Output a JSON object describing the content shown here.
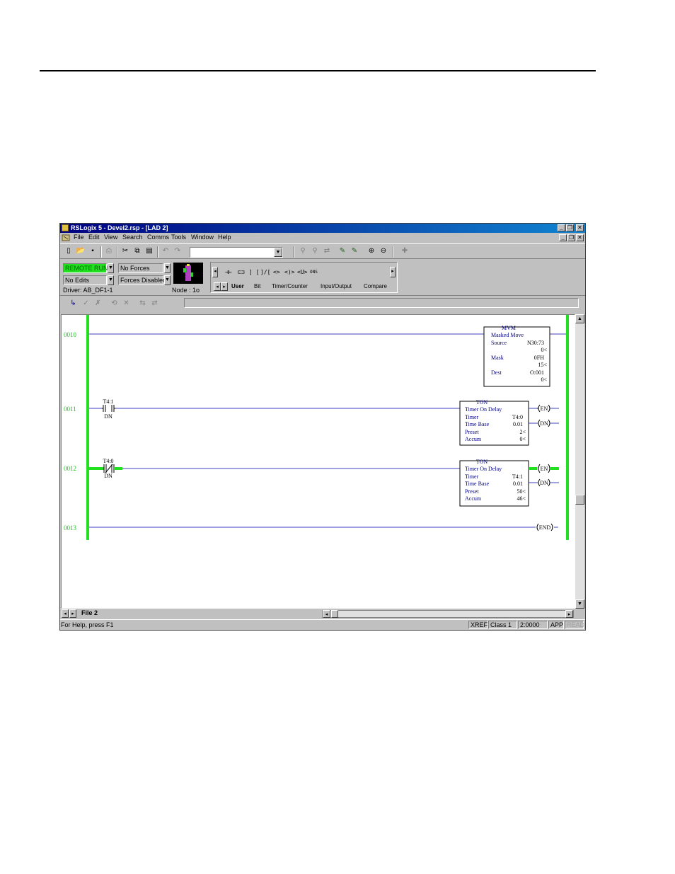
{
  "window": {
    "title": "RSLogix 5 - Devel2.rsp - [LAD 2]"
  },
  "menu": [
    "File",
    "Edit",
    "View",
    "Search",
    "Comms",
    "Tools",
    "Window",
    "Help"
  ],
  "status_panel": {
    "mode": "REMOTE RUN",
    "forces": "No Forces",
    "edits": "No Edits",
    "forces_enabled": "Forces Disabled",
    "driver": "Driver: AB_DF1-1",
    "node": "Node : 1o"
  },
  "instruction_palette": {
    "symbols": [
      "⊣⊢",
      "⊏⊐",
      "] [",
      "]/[",
      "<>",
      "<)>",
      "<U>",
      "ONS"
    ],
    "tabs": [
      "User",
      "Bit",
      "Timer/Counter",
      "Input/Output",
      "Compare"
    ]
  },
  "rungs": [
    {
      "number": "0010",
      "block": {
        "name": "MVM",
        "title": "Masked Move",
        "rows": [
          [
            "Source",
            "N30:73"
          ],
          [
            "",
            "0<"
          ],
          [
            "Mask",
            "0FH"
          ],
          [
            "",
            "15<"
          ],
          [
            "Dest",
            "O:001"
          ],
          [
            "",
            "0<"
          ]
        ]
      }
    },
    {
      "number": "0011",
      "contact": {
        "address": "T4:1",
        "bit": "DN"
      },
      "block": {
        "name": "TON",
        "title": "Timer On Delay",
        "rows": [
          [
            "Timer",
            "T4:0"
          ],
          [
            "Time Base",
            "0.01"
          ],
          [
            "Preset",
            "2<"
          ],
          [
            "Accum",
            "0<"
          ]
        ]
      },
      "outputs": [
        "EN",
        "DN"
      ]
    },
    {
      "number": "0012",
      "contact": {
        "address": "T4:0",
        "bit": "DN"
      },
      "block": {
        "name": "TON",
        "title": "Timer On Delay",
        "rows": [
          [
            "Timer",
            "T4:1"
          ],
          [
            "Time Base",
            "0.01"
          ],
          [
            "Preset",
            "50<"
          ],
          [
            "Accum",
            "46<"
          ]
        ]
      },
      "outputs": [
        "EN",
        "DN"
      ]
    },
    {
      "number": "0013",
      "end": "END"
    }
  ],
  "file_tab": "File 2",
  "statusbar": {
    "help": "For Help, press F1",
    "xref": "XREF",
    "class": "Class 1",
    "address": "2:0000",
    "app": "APP",
    "read": "READ"
  },
  "colors": {
    "power_rail": "#20e020",
    "rung_wire": "#4040c0",
    "rung_number": "#20c020",
    "energized": "#20e020"
  }
}
